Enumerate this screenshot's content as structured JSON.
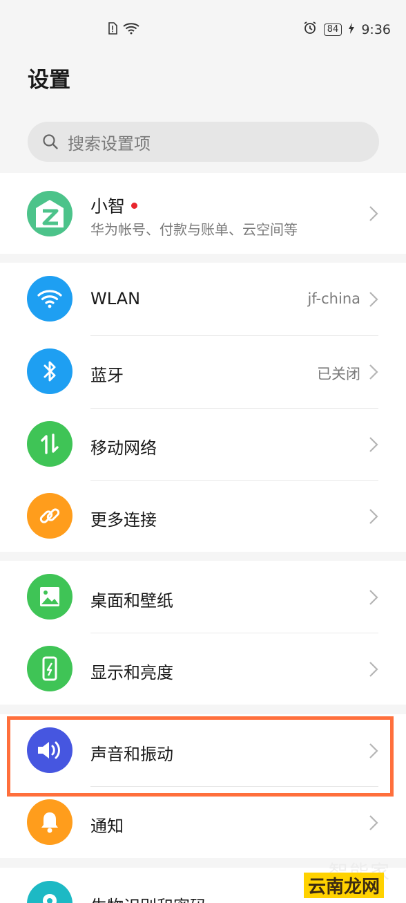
{
  "status_bar": {
    "time": "9:36",
    "battery": "84",
    "icons": [
      "sim-alert-icon",
      "wifi-icon",
      "alarm-icon",
      "battery-icon",
      "charging-icon"
    ]
  },
  "page": {
    "title": "设置"
  },
  "search": {
    "placeholder": "搜索设置项"
  },
  "account": {
    "name": "小智",
    "subtitle": "华为帐号、付款与账单、云空间等",
    "avatar_color": "#4cc38a"
  },
  "sections": {
    "network": [
      {
        "label": "WLAN",
        "value": "jf-china",
        "icon": "wifi-icon",
        "color": "#1e9ff2"
      },
      {
        "label": "蓝牙",
        "value": "已关闭",
        "icon": "bluetooth-icon",
        "color": "#1e9ff2"
      },
      {
        "label": "移动网络",
        "value": "",
        "icon": "mobile-data-icon",
        "color": "#3fc456"
      },
      {
        "label": "更多连接",
        "value": "",
        "icon": "link-icon",
        "color": "#ff9d1c"
      }
    ],
    "display": [
      {
        "label": "桌面和壁纸",
        "icon": "wallpaper-icon",
        "color": "#3fc456"
      },
      {
        "label": "显示和亮度",
        "icon": "brightness-icon",
        "color": "#3fc456"
      }
    ],
    "sound": [
      {
        "label": "声音和振动",
        "icon": "speaker-icon",
        "color": "#4656e0"
      },
      {
        "label": "通知",
        "icon": "bell-icon",
        "color": "#ff9d1c"
      }
    ],
    "security": [
      {
        "label": "生物识别和密码",
        "icon": "location-pin-icon",
        "color": "#1db9c4"
      }
    ]
  },
  "colors": {
    "highlight": "#ff6f3c",
    "background": "#f5f5f5"
  },
  "watermark": {
    "top": "智能家",
    "site": "云南龙网"
  }
}
